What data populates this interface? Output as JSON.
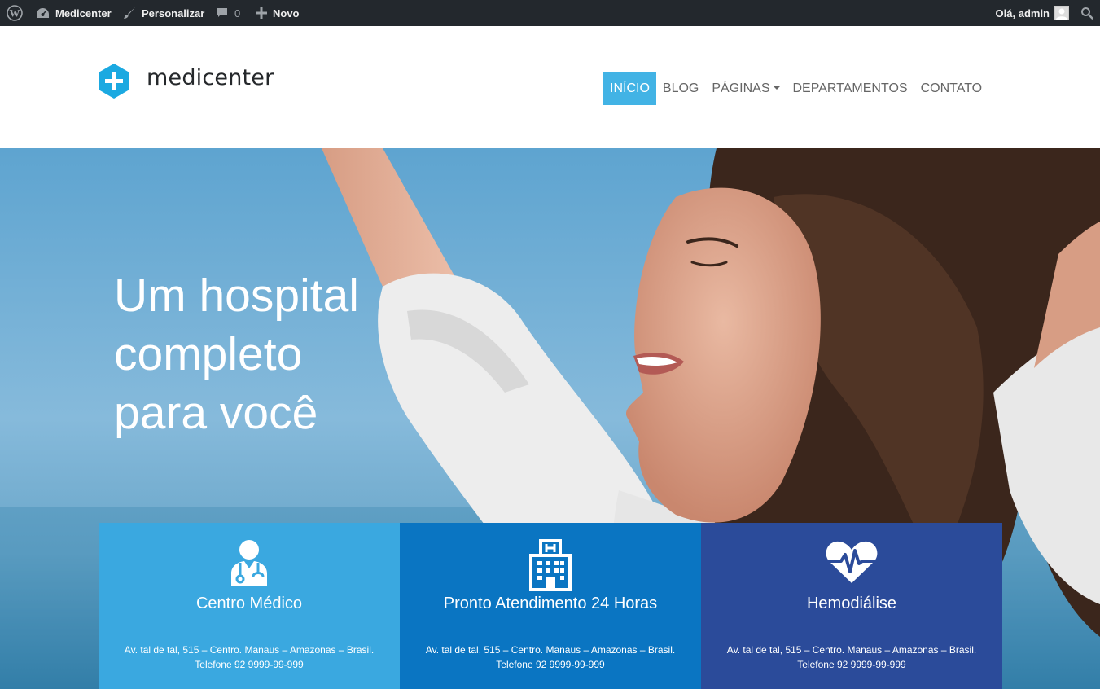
{
  "admin_bar": {
    "site_name": "Medicenter",
    "customize_label": "Personalizar",
    "comments_count": "0",
    "new_label": "Novo",
    "howdy": "Olá, admin"
  },
  "header": {
    "logo_text": "medicenter",
    "nav": [
      {
        "label": "Início",
        "active": true
      },
      {
        "label": "Blog"
      },
      {
        "label": "Páginas",
        "dropdown": true
      },
      {
        "label": "Departamentos"
      },
      {
        "label": "Contato"
      }
    ]
  },
  "hero": {
    "title_line1": "Um hospital",
    "title_line2": "completo",
    "title_line3": "para você"
  },
  "features": [
    {
      "title": "Centro Médico",
      "address": "Av. tal de tal, 515 – Centro. Manaus – Amazonas – Brasil.",
      "phone": "Telefone 92 9999-99-999",
      "color": "#3aa8e0",
      "icon": "doctor-icon"
    },
    {
      "title": "Pronto Atendimento 24 Horas",
      "address": "Av. tal de tal, 515 – Centro. Manaus – Amazonas – Brasil.",
      "phone": "Telefone 92 9999-99-999",
      "color": "#0a75c2",
      "icon": "hospital-icon"
    },
    {
      "title": "Hemodiálise",
      "address": "Av. tal de tal, 515 – Centro. Manaus – Amazonas – Brasil.",
      "phone": "Telefone 92 9999-99-999",
      "color": "#2b4b9a",
      "icon": "heartbeat-icon"
    }
  ],
  "colors": {
    "admin_bar_bg": "#23282d",
    "accent": "#42b3e5",
    "logo_hex": "#1ba9e1"
  }
}
